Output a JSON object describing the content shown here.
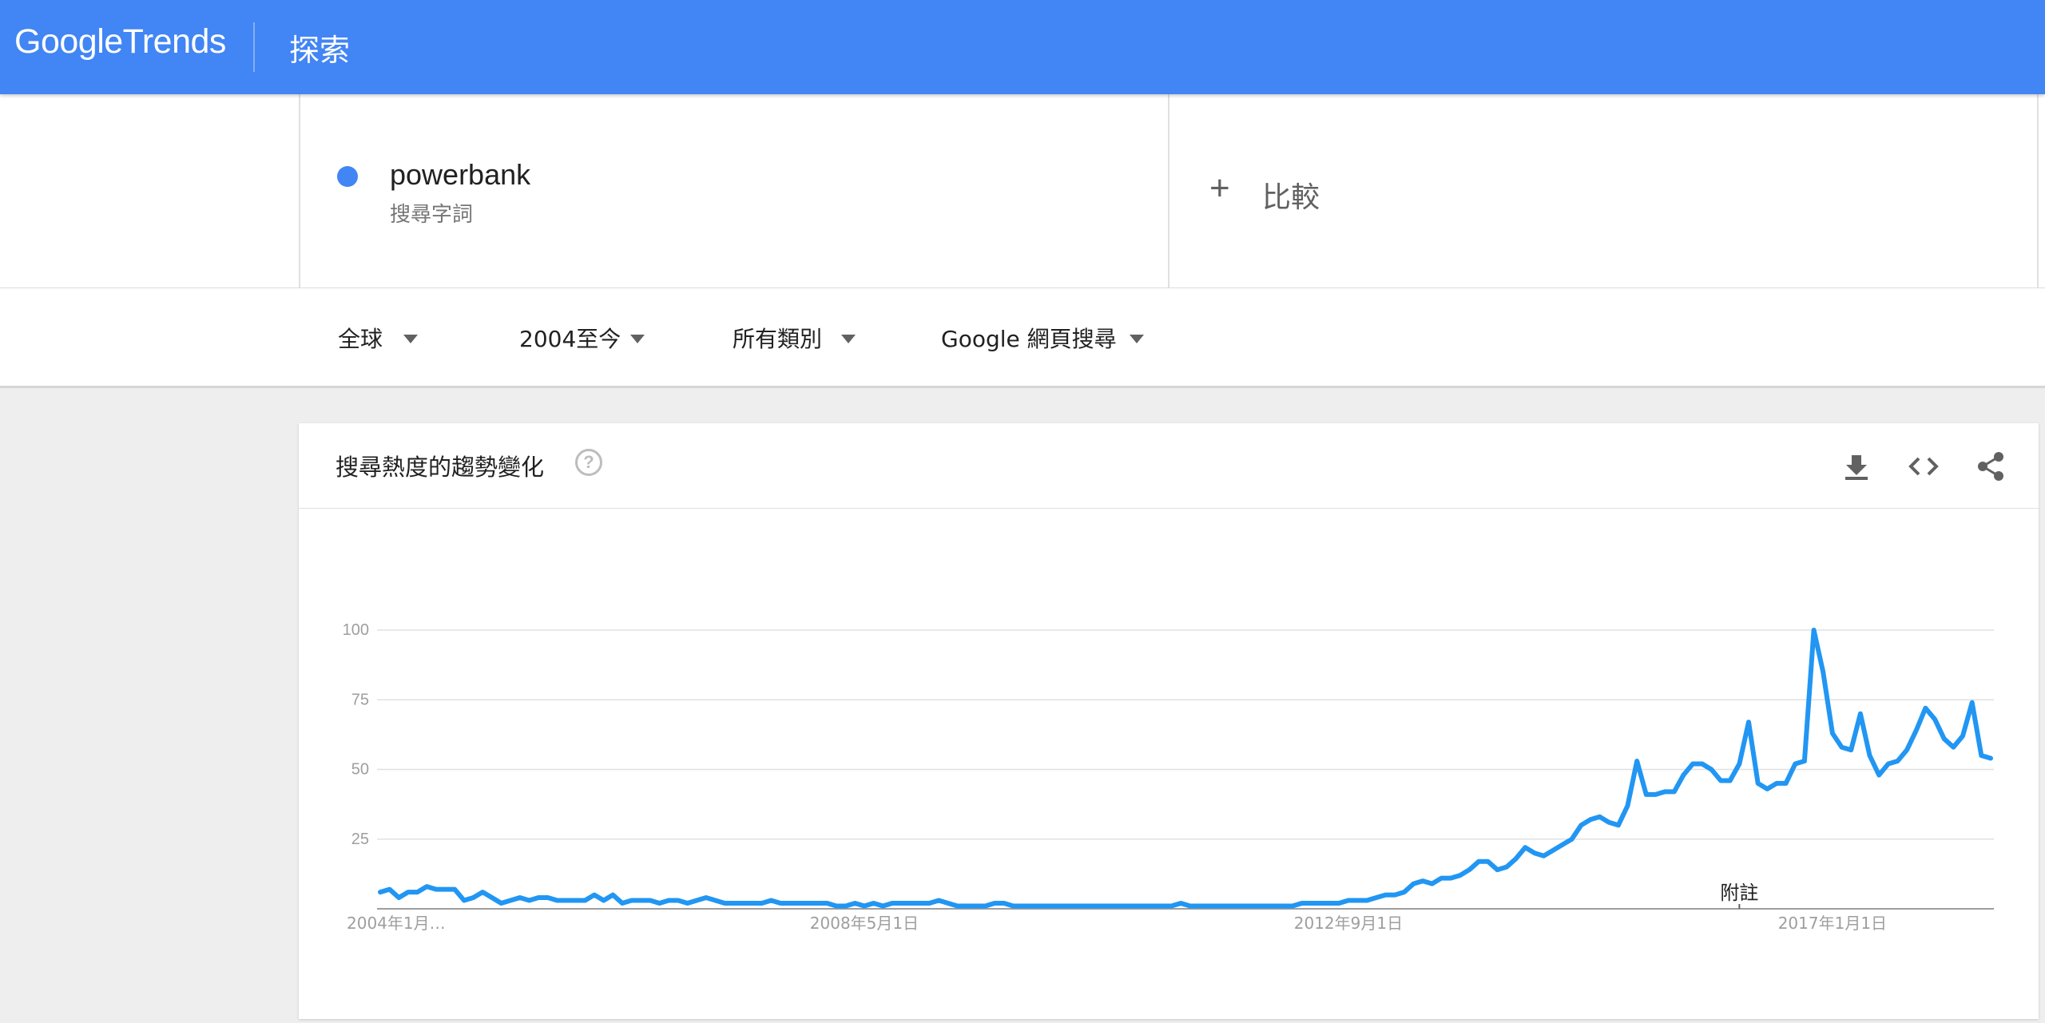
{
  "header": {
    "logo_google": "Google",
    "logo_trends": "Trends",
    "explore": "探索",
    "bg_color": "#4285f4"
  },
  "search_term": {
    "name": "powerbank",
    "type": "搜尋字詞",
    "color": "#4285f4"
  },
  "compare": {
    "plus_icon": "+",
    "label": "比較"
  },
  "filters": {
    "region": "全球",
    "time": "2004至今",
    "category": "所有類別",
    "property": "Google 網頁搜尋"
  },
  "card": {
    "title": "搜尋熱度的趨勢變化",
    "help_icon": "?",
    "icons": [
      "download-icon",
      "embed-code-icon",
      "share-icon"
    ]
  },
  "chart_data": {
    "type": "line",
    "title": "",
    "xlabel": "",
    "ylabel": "",
    "ylim": [
      0,
      100
    ],
    "y_ticks": [
      25,
      50,
      75,
      100
    ],
    "x_tick_labels": [
      {
        "label": "2004年1月…",
        "month_index": 0
      },
      {
        "label": "2008年5月1日",
        "month_index": 52
      },
      {
        "label": "2012年9月1日",
        "month_index": 104
      },
      {
        "label": "2017年1月1日",
        "month_index": 156
      }
    ],
    "annotation": {
      "label": "附註",
      "month_index": 146
    },
    "grid": true,
    "legend": "none",
    "series": [
      {
        "color": "#2196f3",
        "values": [
          6,
          7,
          4,
          6,
          6,
          8,
          7,
          7,
          7,
          3,
          4,
          6,
          4,
          2,
          3,
          4,
          3,
          4,
          4,
          3,
          3,
          3,
          3,
          5,
          3,
          5,
          2,
          3,
          3,
          3,
          2,
          3,
          3,
          2,
          3,
          4,
          3,
          2,
          2,
          2,
          2,
          2,
          3,
          2,
          2,
          2,
          2,
          2,
          2,
          1,
          1,
          2,
          1,
          2,
          1,
          2,
          2,
          2,
          2,
          2,
          3,
          2,
          1,
          1,
          1,
          1,
          2,
          2,
          1,
          1,
          1,
          1,
          1,
          1,
          1,
          1,
          1,
          1,
          1,
          1,
          1,
          1,
          1,
          1,
          1,
          1,
          2,
          1,
          1,
          1,
          1,
          1,
          1,
          1,
          1,
          1,
          1,
          1,
          1,
          2,
          2,
          2,
          2,
          2,
          3,
          3,
          3,
          4,
          5,
          5,
          6,
          9,
          10,
          9,
          11,
          11,
          12,
          14,
          17,
          17,
          14,
          15,
          18,
          22,
          20,
          19,
          21,
          23,
          25,
          30,
          32,
          33,
          31,
          30,
          37,
          53,
          41,
          41,
          42,
          42,
          48,
          52,
          52,
          50,
          46,
          46,
          52,
          67,
          45,
          43,
          45,
          45,
          52,
          53,
          100,
          85,
          63,
          58,
          57,
          70,
          55,
          48,
          52,
          53,
          57,
          64,
          72,
          68,
          61,
          58,
          62,
          74,
          55,
          54
        ]
      }
    ]
  }
}
